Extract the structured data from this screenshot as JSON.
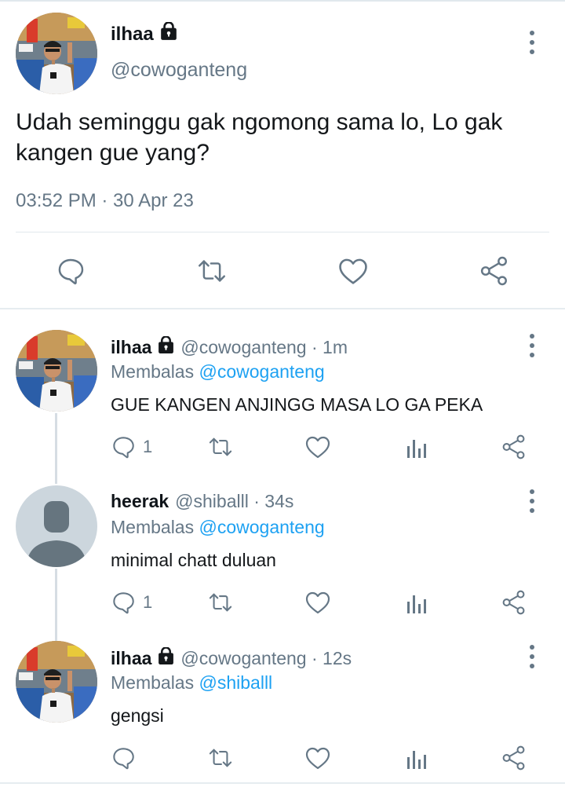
{
  "main_tweet": {
    "author_name": "ilhaa",
    "author_handle": "@cowoganteng",
    "text": "Udah seminggu gak ngomong sama lo, Lo gak kangen gue yang?",
    "timestamp": "03:52 PM · 30 Apr 23"
  },
  "replies": [
    {
      "author_name": "ilhaa",
      "meta": "@cowoganteng · 1m",
      "replying_label": "Membalas",
      "replying_to": "@cowoganteng",
      "text": "GUE KANGEN ANJINGG MASA LO GA PEKA",
      "reply_count": "1"
    },
    {
      "author_name": "heerak",
      "meta": "@shiballl · 34s",
      "replying_label": "Membalas",
      "replying_to": "@cowoganteng",
      "text": "minimal chatt duluan",
      "reply_count": "1"
    },
    {
      "author_name": "ilhaa",
      "meta": "@cowoganteng · 12s",
      "replying_label": "Membalas",
      "replying_to": "@shiballl",
      "text": "gengsi",
      "reply_count": ""
    }
  ],
  "icons": {
    "reply": "reply-icon",
    "retweet": "retweet-icon",
    "like": "heart-icon",
    "share": "share-icon",
    "analytics": "analytics-icon",
    "more": "more-vertical-icon",
    "lock": "lock-icon"
  },
  "colors": {
    "link": "#1da1f2",
    "secondary_text": "#657786",
    "divider": "#e1e8ed"
  }
}
